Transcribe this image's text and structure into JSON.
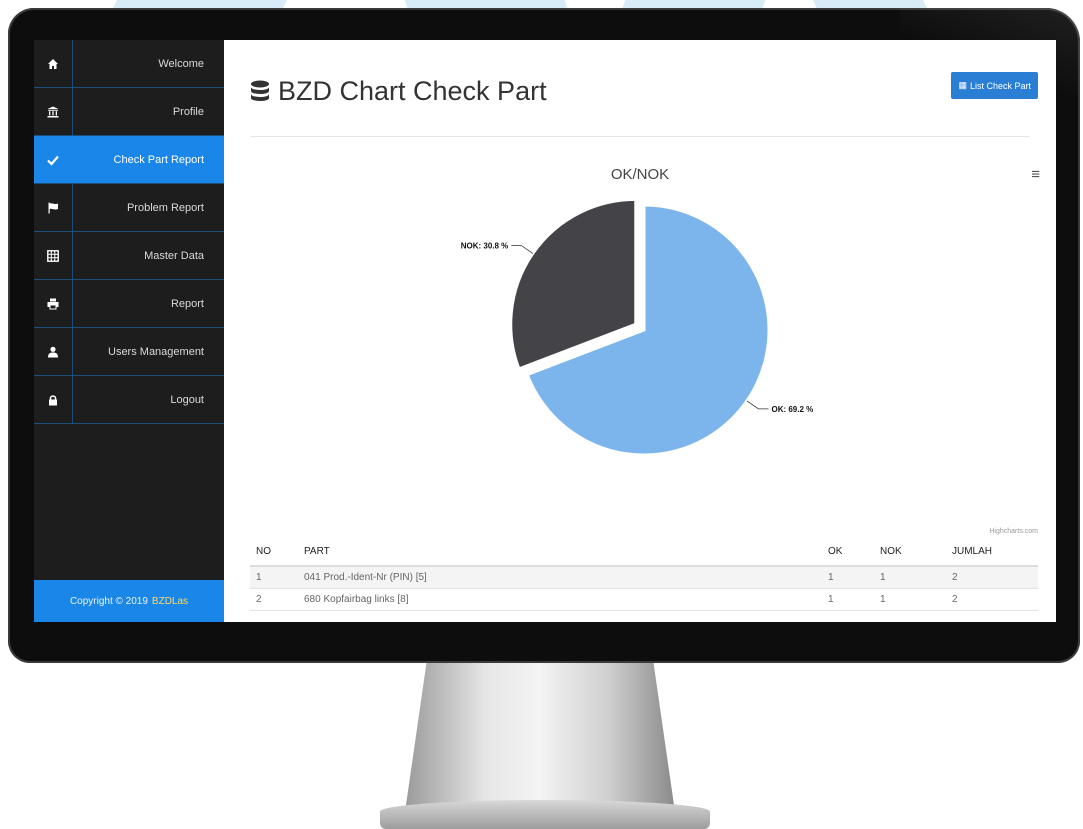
{
  "sidebar": {
    "items": [
      {
        "label": "Welcome",
        "icon": "home-icon",
        "active": false
      },
      {
        "label": "Profile",
        "icon": "bank-icon",
        "active": false
      },
      {
        "label": "Check Part Report",
        "icon": "check-icon",
        "active": true
      },
      {
        "label": "Problem Report",
        "icon": "flag-icon",
        "active": false
      },
      {
        "label": "Master Data",
        "icon": "table-icon",
        "active": false
      },
      {
        "label": "Report",
        "icon": "print-icon",
        "active": false
      },
      {
        "label": "Users Management",
        "icon": "user-icon",
        "active": false
      },
      {
        "label": "Logout",
        "icon": "lock-icon",
        "active": false
      }
    ],
    "footer": {
      "text": "Copyright © 2019",
      "brand": "BZDLas"
    }
  },
  "header": {
    "title": "BZD Chart Check Part",
    "title_icon": "database-icon",
    "list_button": "List Check Part",
    "list_button_icon": "table-icon"
  },
  "chart_data": {
    "type": "pie",
    "title": "OK/NOK",
    "slices": [
      {
        "label": "OK",
        "value": 69.2,
        "display": "OK: 69.2 %",
        "color": "#7cb5ec"
      },
      {
        "label": "NOK",
        "value": 30.8,
        "display": "NOK: 30.8 %",
        "color": "#434348"
      }
    ],
    "credit": "Highcharts.com"
  },
  "table": {
    "headers": [
      "NO",
      "PART",
      "OK",
      "NOK",
      "JUMLAH"
    ],
    "rows": [
      [
        "1",
        "041 Prod.-Ident-Nr (PIN) [5]",
        "1",
        "1",
        "2"
      ],
      [
        "2",
        "680 Kopfairbag links [8]",
        "1",
        "1",
        "2"
      ]
    ]
  },
  "colors": {
    "accent": "#1a87e8",
    "sidebar": "#1d1d1d",
    "ok": "#7cb5ec",
    "nok": "#434348"
  }
}
